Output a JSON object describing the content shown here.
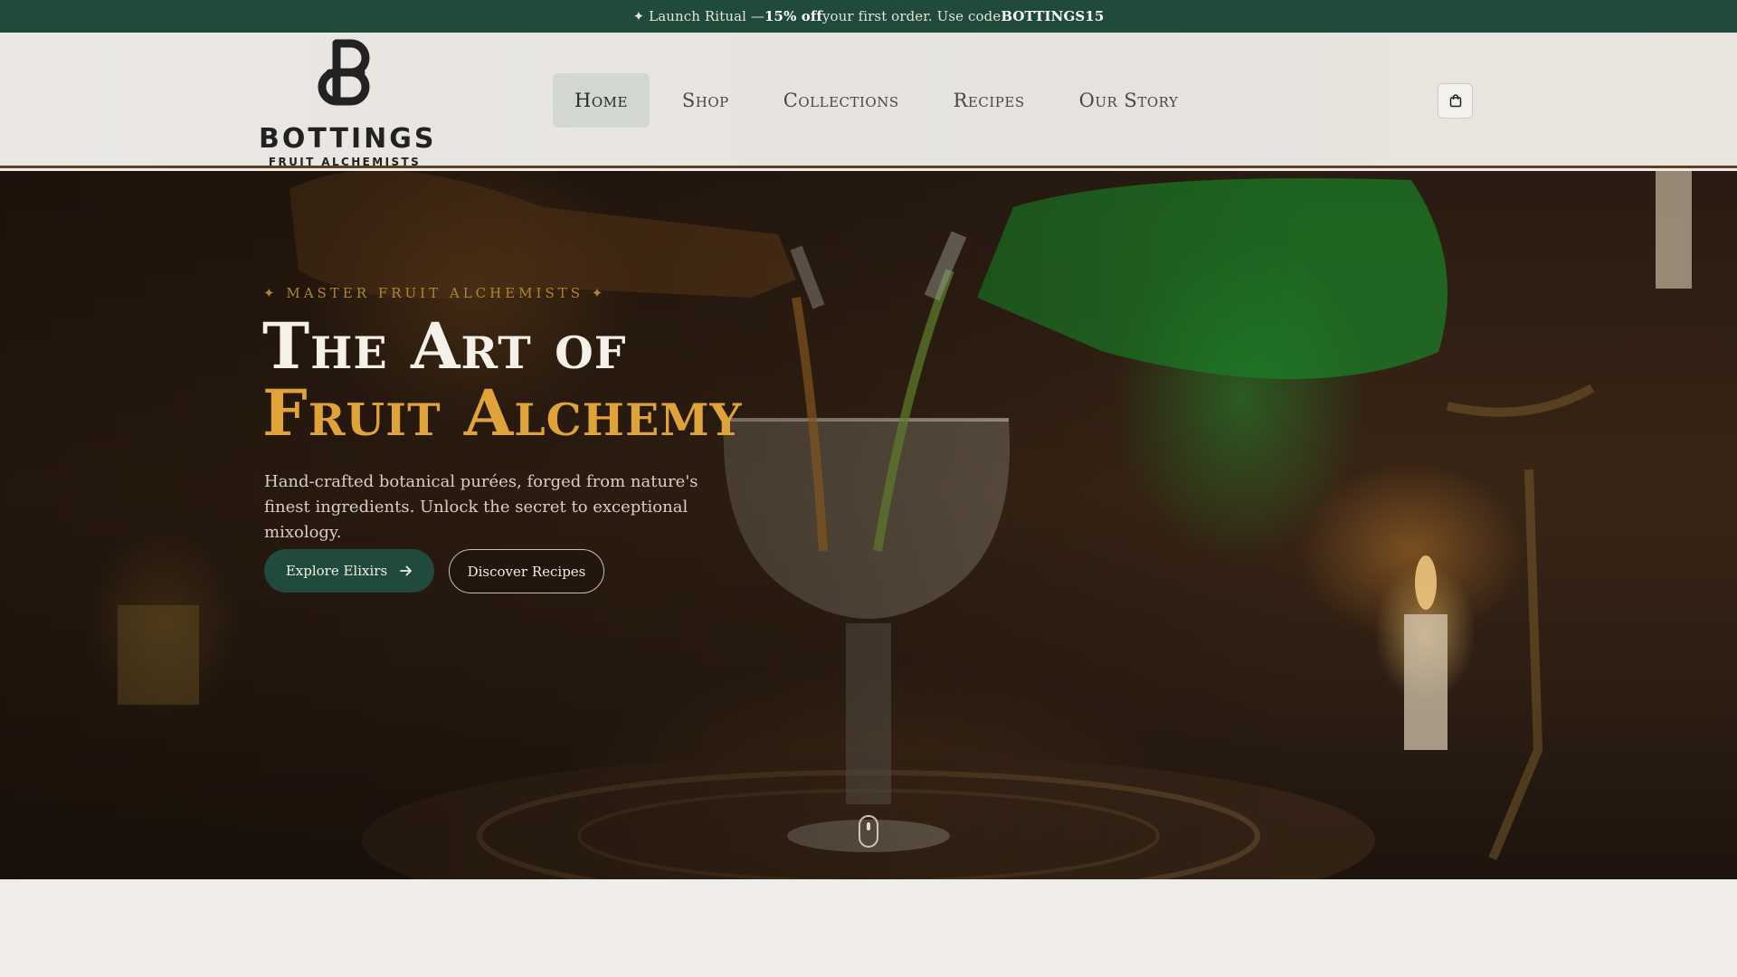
{
  "promo": {
    "icon": "sparkle-icon",
    "text_before": "✦ Launch Ritual — ",
    "bold_offer": "15% off",
    "text_middle": " your first order. Use code ",
    "code": "BOTTINGS15"
  },
  "header": {
    "logo_word": "BOTTINGS",
    "logo_sub": "FRUIT ALCHEMISTS",
    "nav": [
      {
        "label": "Home",
        "active": true
      },
      {
        "label": "Shop",
        "active": false
      },
      {
        "label": "Collections",
        "active": false
      },
      {
        "label": "Recipes",
        "active": false
      },
      {
        "label": "Our Story",
        "active": false
      }
    ],
    "cart_icon": "shopping-bag-icon"
  },
  "hero": {
    "eyebrow": "✦ MASTER FRUIT ALCHEMISTS ✦",
    "title_line1": "The Art of",
    "title_line2": "Fruit Alchemy",
    "lede": "Hand-crafted botanical purées, forged from nature's finest ingredients. Unlock the secret to exceptional mixology.",
    "primary_cta": "Explore Elixirs",
    "primary_cta_icon": "arrow-right-icon",
    "secondary_cta": "Discover Recipes",
    "scroll_icon": "mouse-scroll-icon"
  },
  "colors": {
    "brand_green": "#1f4a3c",
    "gold": "#e0a33a",
    "cream": "#f6f1e8"
  }
}
